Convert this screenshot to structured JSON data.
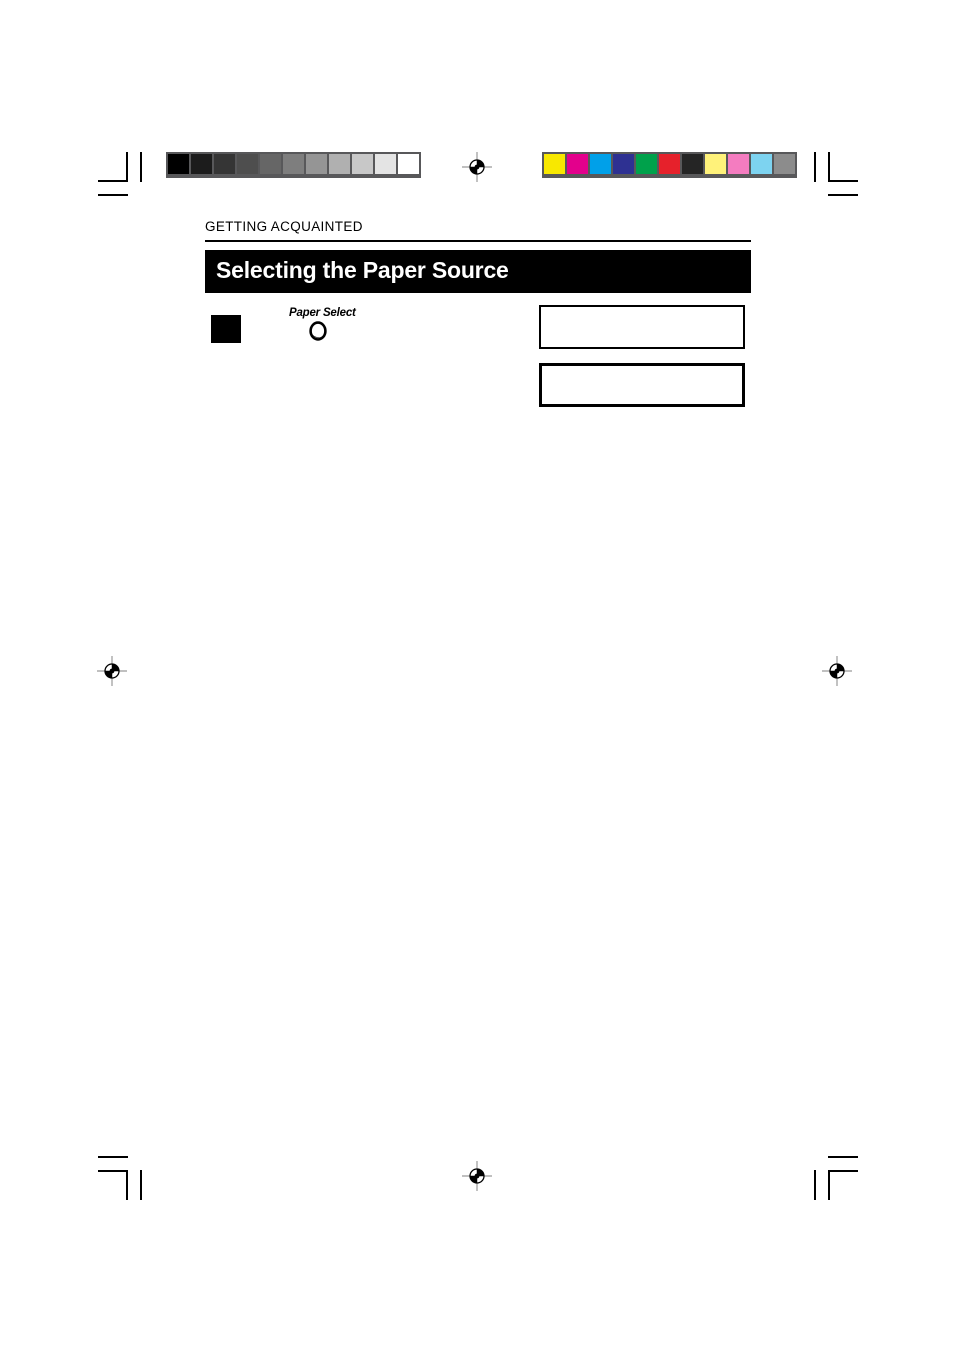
{
  "document": {
    "running_head": "GETTING ACQUAINTED",
    "section_title": "Selecting the Paper Source",
    "control_label": "Paper Select",
    "icons": {
      "step_marker": "filled-square-marker",
      "control_button": "round-button-icon",
      "registration_target": "registration-target-icon"
    },
    "display_panels": [
      {
        "name": "lcd-panel-upper",
        "text": ""
      },
      {
        "name": "lcd-panel-lower",
        "text": ""
      }
    ]
  },
  "print_marks": {
    "grayscale_strip": {
      "label": "grayscale-calibration-strip",
      "frame_color": "#58585a",
      "patches": [
        "#000000",
        "#1c1c1c",
        "#353535",
        "#4e4e4e",
        "#666666",
        "#7e7e7e",
        "#959595",
        "#b0b0b0",
        "#c8c8c8",
        "#e4e4e4",
        "#ffffff"
      ]
    },
    "color_strip": {
      "label": "color-calibration-strip",
      "frame_color": "#58585a",
      "patches": [
        "#f8e800",
        "#e3008c",
        "#00a0e9",
        "#2e3192",
        "#00a14b",
        "#e6212b",
        "#252525",
        "#fff27a",
        "#f47cc0",
        "#7dd3f0",
        "#8c8c8c"
      ]
    },
    "registration_targets": [
      {
        "name": "reg-target-top-center"
      },
      {
        "name": "reg-target-left-middle"
      },
      {
        "name": "reg-target-right-middle"
      },
      {
        "name": "reg-target-bottom-center"
      }
    ],
    "crop_marks": [
      {
        "name": "crop-mark-top-left"
      },
      {
        "name": "crop-mark-top-right"
      },
      {
        "name": "crop-mark-bottom-left"
      },
      {
        "name": "crop-mark-bottom-right"
      }
    ]
  }
}
